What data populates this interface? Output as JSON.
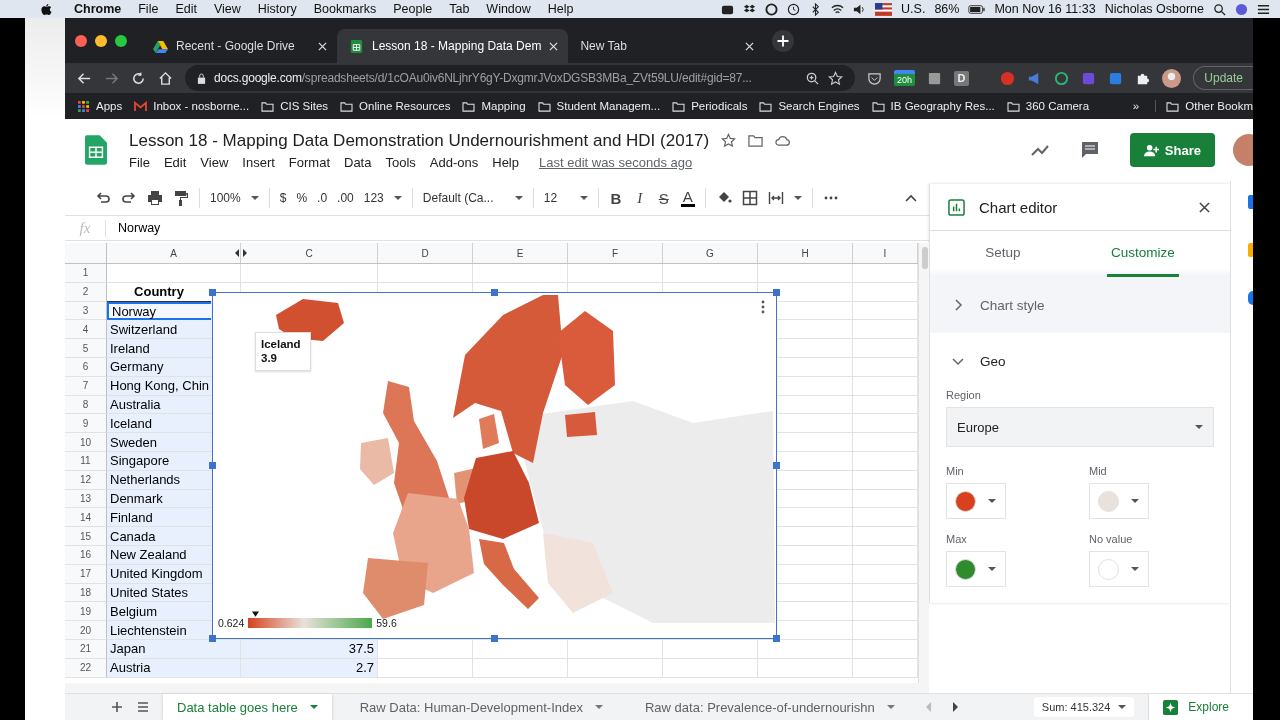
{
  "menubar": {
    "app": "Chrome",
    "menus": [
      "File",
      "Edit",
      "View",
      "History",
      "Bookmarks",
      "People",
      "Tab",
      "Window",
      "Help"
    ],
    "input_source": "U.S.",
    "battery": "86%",
    "datetime": "Mon Nov 16  11:33",
    "user": "Nicholas Osborne"
  },
  "browser": {
    "tabs": [
      {
        "title": "Recent - Google Drive",
        "kind": "drive",
        "selected": false
      },
      {
        "title": "Lesson 18 - Mapping Data Dem",
        "kind": "sheets",
        "selected": true
      },
      {
        "title": "New Tab",
        "kind": "blank",
        "selected": false
      }
    ],
    "url_host": "docs.google.com",
    "url_path": "/spreadsheets/d/1cOAu0iv6NLjhrY6gY-DxgmrJVoxDGSB3MBa_ZVt59LU/edit#gid=87...",
    "extension_badge": "20h",
    "extension_letter": "D",
    "update": "Update",
    "bookmarks": [
      {
        "label": "Apps",
        "kind": "apps"
      },
      {
        "label": "Inbox - nosborne...",
        "kind": "mail"
      },
      {
        "label": "CIS Sites",
        "kind": "folder"
      },
      {
        "label": "Online Resources",
        "kind": "folder"
      },
      {
        "label": "Mapping",
        "kind": "folder"
      },
      {
        "label": "Student Managem...",
        "kind": "folder"
      },
      {
        "label": "Periodicals",
        "kind": "folder"
      },
      {
        "label": "Search Engines",
        "kind": "folder"
      },
      {
        "label": "IB Geography Res...",
        "kind": "folder"
      },
      {
        "label": "360 Camera",
        "kind": "folder"
      }
    ],
    "more": "»",
    "other_bookmarks": "Other Bookm"
  },
  "sheet": {
    "title": "Lesson 18 -  Mapping Data Demonstration Undernourishment and HDI  (2017)",
    "menus": [
      "File",
      "Edit",
      "View",
      "Insert",
      "Format",
      "Data",
      "Tools",
      "Add-ons",
      "Help"
    ],
    "last_edit": "Last edit was seconds ago",
    "share": "Share"
  },
  "toolbar": {
    "zoom": "100%",
    "formats": [
      "$",
      "%",
      ".0",
      ".00",
      "123"
    ],
    "font": "Default (Ca...",
    "size": "12",
    "styles": [
      {
        "label": "B",
        "kind": "bold"
      },
      {
        "label": "I",
        "kind": "italic"
      },
      {
        "label": "S",
        "kind": "strike"
      },
      {
        "label": "A",
        "kind": "color"
      }
    ]
  },
  "formula": {
    "label": "fx",
    "value": "Norway"
  },
  "columns": [
    "A",
    "C",
    "D",
    "E",
    "F",
    "G",
    "H",
    "I"
  ],
  "rows": [
    {
      "n": "1",
      "selected": false,
      "active": false
    },
    {
      "n": "2",
      "a": "Country",
      "selected": false,
      "active": false
    },
    {
      "n": "3",
      "a": "Norway",
      "selected": true,
      "active": true
    },
    {
      "n": "4",
      "a": "Switzerland",
      "selected": true,
      "active": false
    },
    {
      "n": "5",
      "a": "Ireland",
      "selected": true,
      "active": false
    },
    {
      "n": "6",
      "a": "Germany",
      "selected": true,
      "active": false
    },
    {
      "n": "7",
      "a": "Hong Kong, Chin",
      "selected": true,
      "active": false
    },
    {
      "n": "8",
      "a": "Australia",
      "selected": true,
      "active": false
    },
    {
      "n": "9",
      "a": "Iceland",
      "selected": true,
      "active": false
    },
    {
      "n": "10",
      "a": "Sweden",
      "selected": true,
      "active": false
    },
    {
      "n": "11",
      "a": "Singapore",
      "selected": true,
      "active": false
    },
    {
      "n": "12",
      "a": "Netherlands",
      "selected": true,
      "active": false
    },
    {
      "n": "13",
      "a": "Denmark",
      "selected": true,
      "active": false
    },
    {
      "n": "14",
      "a": "Finland",
      "selected": true,
      "active": false
    },
    {
      "n": "15",
      "a": "Canada",
      "selected": true,
      "active": false
    },
    {
      "n": "16",
      "a": "New Zealand",
      "selected": true,
      "active": false
    },
    {
      "n": "17",
      "a": "United Kingdom",
      "selected": true,
      "active": false
    },
    {
      "n": "18",
      "a": "United States",
      "selected": true,
      "active": false
    },
    {
      "n": "19",
      "a": "Belgium",
      "selected": true,
      "active": false
    },
    {
      "n": "20",
      "a": "Liechtenstein",
      "selected": true,
      "active": false
    },
    {
      "n": "21",
      "a": "Japan",
      "c": "37.5",
      "selected": true,
      "active": false
    },
    {
      "n": "22",
      "a": "Austria",
      "c": "2.7",
      "selected": true,
      "active": false
    }
  ],
  "chart": {
    "tooltip": {
      "title": "Iceland",
      "value": "3.9"
    },
    "legend": {
      "min": "0.624",
      "max": "59.6",
      "level": 0.06
    }
  },
  "editor": {
    "title": "Chart editor",
    "tabs": [
      {
        "label": "Setup",
        "selected": false
      },
      {
        "label": "Customize",
        "selected": true
      }
    ],
    "sections": [
      {
        "label": "Chart style",
        "expanded": false
      },
      {
        "label": "Geo",
        "expanded": true
      }
    ],
    "region_label": "Region",
    "region": "Europe",
    "colors": [
      {
        "label": "Min",
        "color": "#d9401f"
      },
      {
        "label": "Mid",
        "color": "#e9e2dc"
      },
      {
        "label": "Max",
        "color": "#2e8b2e"
      },
      {
        "label": "No value",
        "color": "#ffffff"
      }
    ]
  },
  "sheet_tabs": [
    {
      "label": "Data table goes here",
      "selected": true
    },
    {
      "label": "Raw Data: Human-Development-Index",
      "selected": false
    },
    {
      "label": "Raw data: Prevalence-of-undernourishn",
      "selected": false
    }
  ],
  "sum": "Sum: 415.324",
  "explore": "Explore"
}
